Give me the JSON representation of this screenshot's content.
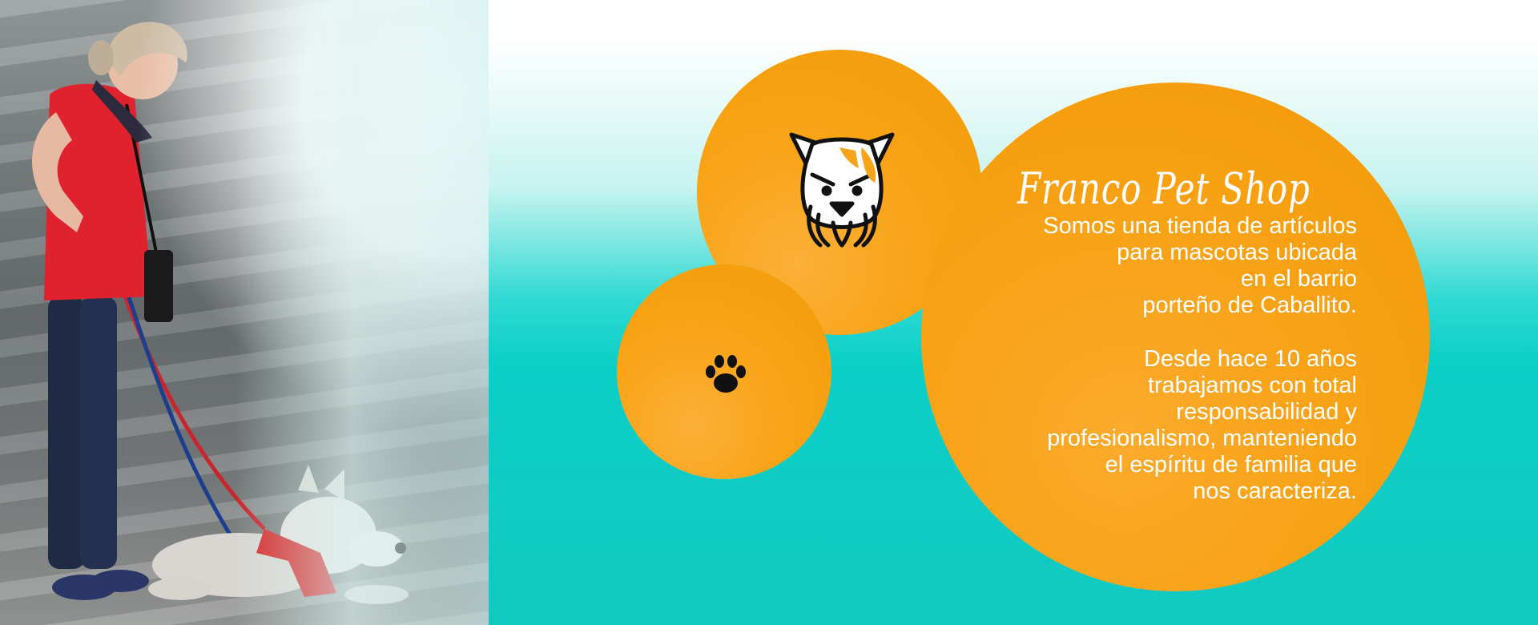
{
  "banner": {
    "brand_title": "Franco Pet Shop",
    "paragraph1_lines": [
      "Somos una tienda de artículos",
      "para mascotas ubicada",
      "en el barrio",
      "porteño de Caballito."
    ],
    "paragraph2_lines": [
      "Desde hace 10 años",
      "trabajamos con total",
      "responsabilidad y",
      "profesionalismo, manteniendo",
      "el espíritu de familia que",
      "nos caracteriza."
    ]
  },
  "icons": {
    "dog": "dog-face-icon",
    "paw": "paw-print-icon"
  },
  "colors": {
    "circle_orange": "#f9a316",
    "teal_background": "#12c9c0",
    "text": "#ffffff"
  }
}
